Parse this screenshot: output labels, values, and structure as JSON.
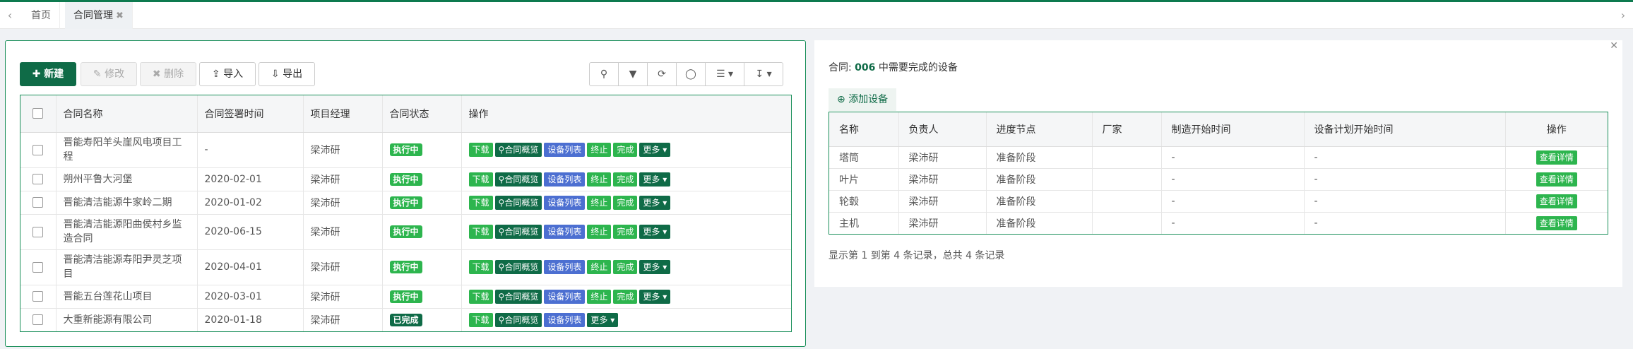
{
  "tabs": [
    {
      "label": "首页"
    },
    {
      "label": "合同管理"
    }
  ],
  "toolbar": {
    "new_label": "新建",
    "edit_label": "修改",
    "delete_label": "删除",
    "import_label": "导入",
    "export_label": "导出"
  },
  "contracts": {
    "columns": [
      "合同名称",
      "合同签署时间",
      "项目经理",
      "合同状态",
      "操作"
    ],
    "rows": [
      {
        "name": "晋能寿阳羊头崖风电项目工程",
        "date": "-",
        "manager": "梁沛研",
        "status": "执行中",
        "status_type": "run",
        "ops": [
          "下载",
          "合同概览",
          "设备列表",
          "终止",
          "完成",
          "更多"
        ]
      },
      {
        "name": "朔州平鲁大河堡",
        "date": "2020-02-01",
        "manager": "梁沛研",
        "status": "执行中",
        "status_type": "run",
        "ops": [
          "下载",
          "合同概览",
          "设备列表",
          "终止",
          "完成",
          "更多"
        ]
      },
      {
        "name": "晋能清洁能源牛家岭二期",
        "date": "2020-01-02",
        "manager": "梁沛研",
        "status": "执行中",
        "status_type": "run",
        "ops": [
          "下载",
          "合同概览",
          "设备列表",
          "终止",
          "完成",
          "更多"
        ]
      },
      {
        "name": "晋能清洁能源阳曲侯村乡监造合同",
        "date": "2020-06-15",
        "manager": "梁沛研",
        "status": "执行中",
        "status_type": "run",
        "ops": [
          "下载",
          "合同概览",
          "设备列表",
          "终止",
          "完成",
          "更多"
        ]
      },
      {
        "name": "晋能清洁能源寿阳尹灵芝项目",
        "date": "2020-04-01",
        "manager": "梁沛研",
        "status": "执行中",
        "status_type": "run",
        "ops": [
          "下载",
          "合同概览",
          "设备列表",
          "终止",
          "完成",
          "更多"
        ]
      },
      {
        "name": "晋能五台莲花山项目",
        "date": "2020-03-01",
        "manager": "梁沛研",
        "status": "执行中",
        "status_type": "run",
        "ops": [
          "下载",
          "合同概览",
          "设备列表",
          "终止",
          "完成",
          "更多"
        ]
      },
      {
        "name": "大重新能源有限公司",
        "date": "2020-01-18",
        "manager": "梁沛研",
        "status": "已完成",
        "status_type": "done",
        "ops": [
          "下载",
          "合同概览",
          "设备列表",
          "更多"
        ]
      }
    ]
  },
  "equipment": {
    "title_prefix": "合同:",
    "contract_no": "006",
    "title_suffix": "中需要完成的设备",
    "add_label": "添加设备",
    "columns": [
      "名称",
      "负责人",
      "进度节点",
      "厂家",
      "制造开始时间",
      "设备计划开始时间",
      "操作"
    ],
    "rows": [
      {
        "name": "塔筒",
        "owner": "梁沛研",
        "stage": "准备阶段",
        "vendor": "",
        "mfg_start": "-",
        "plan_start": "-",
        "action": "查看详情"
      },
      {
        "name": "叶片",
        "owner": "梁沛研",
        "stage": "准备阶段",
        "vendor": "",
        "mfg_start": "-",
        "plan_start": "-",
        "action": "查看详情"
      },
      {
        "name": "轮毂",
        "owner": "梁沛研",
        "stage": "准备阶段",
        "vendor": "",
        "mfg_start": "-",
        "plan_start": "-",
        "action": "查看详情"
      },
      {
        "name": "主机",
        "owner": "梁沛研",
        "stage": "准备阶段",
        "vendor": "",
        "mfg_start": "-",
        "plan_start": "-",
        "action": "查看详情"
      }
    ],
    "pager": "显示第 1 到第 4 条记录，总共 4 条记录"
  }
}
